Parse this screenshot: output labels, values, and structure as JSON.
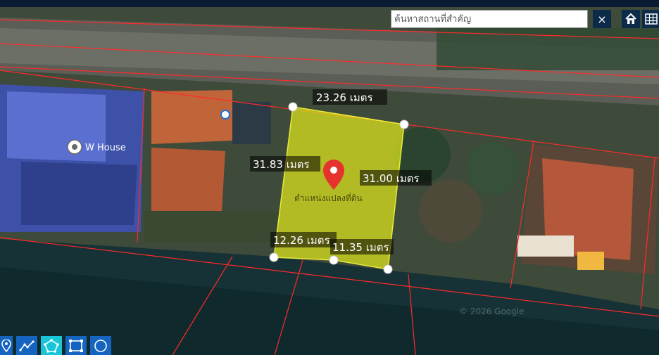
{
  "search": {
    "placeholder": "ค้นหาสถานที่สำคัญ"
  },
  "buttons": {
    "close_glyph": "×"
  },
  "poi": {
    "label": "W House"
  },
  "parcel": {
    "center_label": "ตำแหน่งแปลงที่ดิน",
    "measurements": {
      "top": "23.26 เมตร",
      "left": "31.83 เมตร",
      "right": "31.00 เมตร",
      "bottom_left": "12.26 เมตร",
      "bottom_right": "11.35 เมตร"
    }
  },
  "watermark": "© 2026 Google",
  "toolbar": {
    "tools": [
      "marker-icon",
      "polyline-icon",
      "polygon-icon",
      "rectangle-icon",
      "circle-icon"
    ],
    "active_tool": "polygon-icon"
  },
  "colors": {
    "parcel_fill": "#dfe81a",
    "boundary": "#ff2a2a",
    "toolbar": "#1565c0",
    "toolbar_active": "#19c6d8",
    "pin": "#e5322d"
  }
}
